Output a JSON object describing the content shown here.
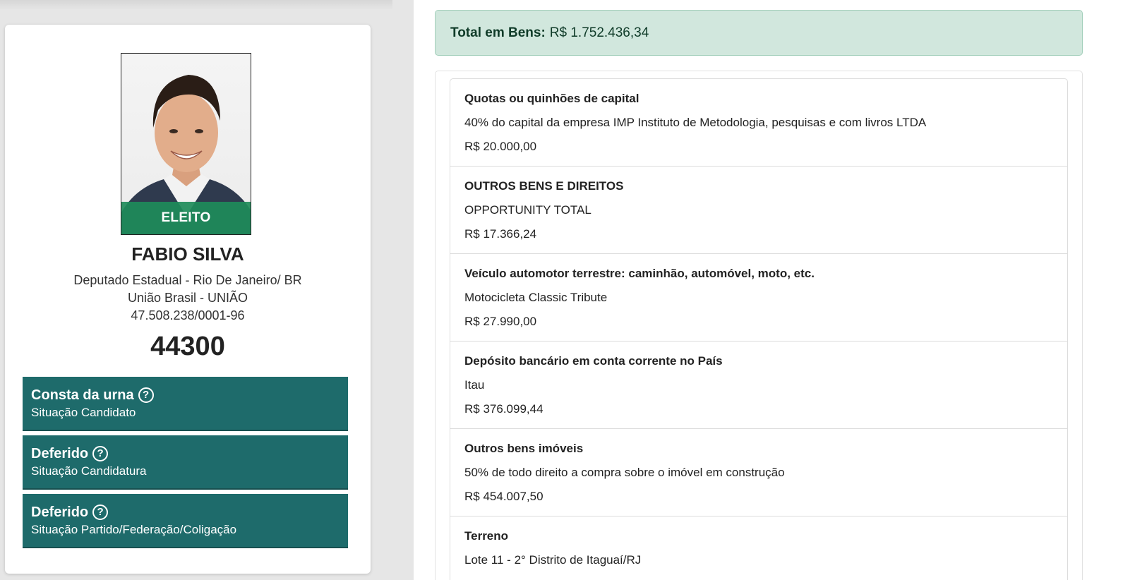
{
  "candidate": {
    "status_badge": "ELEITO",
    "name": "FABIO SILVA",
    "office": "Deputado Estadual - Rio De Janeiro/ BR",
    "party": "União Brasil - UNIÃO",
    "cnpj": "47.508.238/0001-96",
    "number": "44300"
  },
  "statuses": [
    {
      "title": "Consta da urna",
      "subtitle": "Situação Candidato"
    },
    {
      "title": "Deferido",
      "subtitle": "Situação Candidatura"
    },
    {
      "title": "Deferido",
      "subtitle": "Situação Partido/Federação/Coligação"
    }
  ],
  "total": {
    "label": "Total em Bens:",
    "value": "R$ 1.752.436,34"
  },
  "assets": [
    {
      "type": "Quotas ou quinhões de capital",
      "description": "40% do capital da empresa IMP Instituto de Metodologia, pesquisas e com livros LTDA",
      "value": "R$ 20.000,00"
    },
    {
      "type": "OUTROS BENS E DIREITOS",
      "description": "OPPORTUNITY TOTAL",
      "value": "R$ 17.366,24"
    },
    {
      "type": "Veículo automotor terrestre: caminhão, automóvel, moto, etc.",
      "description": "Motocicleta Classic Tribute",
      "value": "R$ 27.990,00"
    },
    {
      "type": "Depósito bancário em conta corrente no País",
      "description": "Itau",
      "value": "R$ 376.099,44"
    },
    {
      "type": "Outros bens imóveis",
      "description": "50% de todo direito a compra sobre o imóvel em construção",
      "value": "R$ 454.007,50"
    },
    {
      "type": "Terreno",
      "description": "Lote 11 - 2° Distrito de Itaguaí/RJ",
      "value": ""
    }
  ],
  "icons": {
    "help": "question-circle-icon"
  },
  "colors": {
    "elected_green": "#1e8c5a",
    "status_teal": "#1e6b6b",
    "total_bg": "#d1e7dd"
  }
}
